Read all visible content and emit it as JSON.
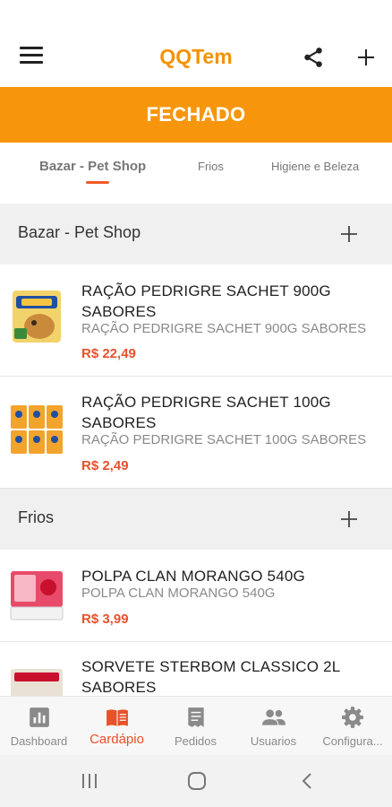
{
  "app": {
    "title": "QQTem"
  },
  "status_banner": "FECHADO",
  "tabs": [
    {
      "label": "Bazar - Pet Shop",
      "active": true
    },
    {
      "label": "Frios",
      "active": false
    },
    {
      "label": "Higiene e Beleza",
      "active": false
    }
  ],
  "sections": [
    {
      "label": "Bazar - Pet Shop"
    },
    {
      "label": "Frios"
    }
  ],
  "products": [
    {
      "name": "RAÇÃO PEDRIGRE SACHET 900G SABORES",
      "description": "RAÇÃO PEDRIGRE SACHET 900G SABORES",
      "price": "R$ 22,49"
    },
    {
      "name": "RAÇÃO PEDRIGRE SACHET 100G SABORES",
      "description": "RAÇÃO PEDRIGRE SACHET 100G SABORES",
      "price": "R$ 2,49"
    },
    {
      "name": "POLPA CLAN MORANGO 540G",
      "description": "POLPA CLAN MORANGO 540G",
      "price": "R$ 3,99"
    },
    {
      "name": "SORVETE STERBOM CLASSICO 2L SABORES",
      "description": "",
      "price": ""
    }
  ],
  "bottom_nav": [
    {
      "label": "Dashboard",
      "icon": "bar-chart-icon",
      "active": false
    },
    {
      "label": "Cardápio",
      "icon": "menu-book-icon",
      "active": true
    },
    {
      "label": "Pedidos",
      "icon": "receipt-icon",
      "active": false
    },
    {
      "label": "Usuarios",
      "icon": "people-icon",
      "active": false
    },
    {
      "label": "Configura...",
      "icon": "gear-icon",
      "active": false
    }
  ],
  "colors": {
    "accent": "#f39200",
    "banner": "#f7960c",
    "price": "#e8512a"
  }
}
